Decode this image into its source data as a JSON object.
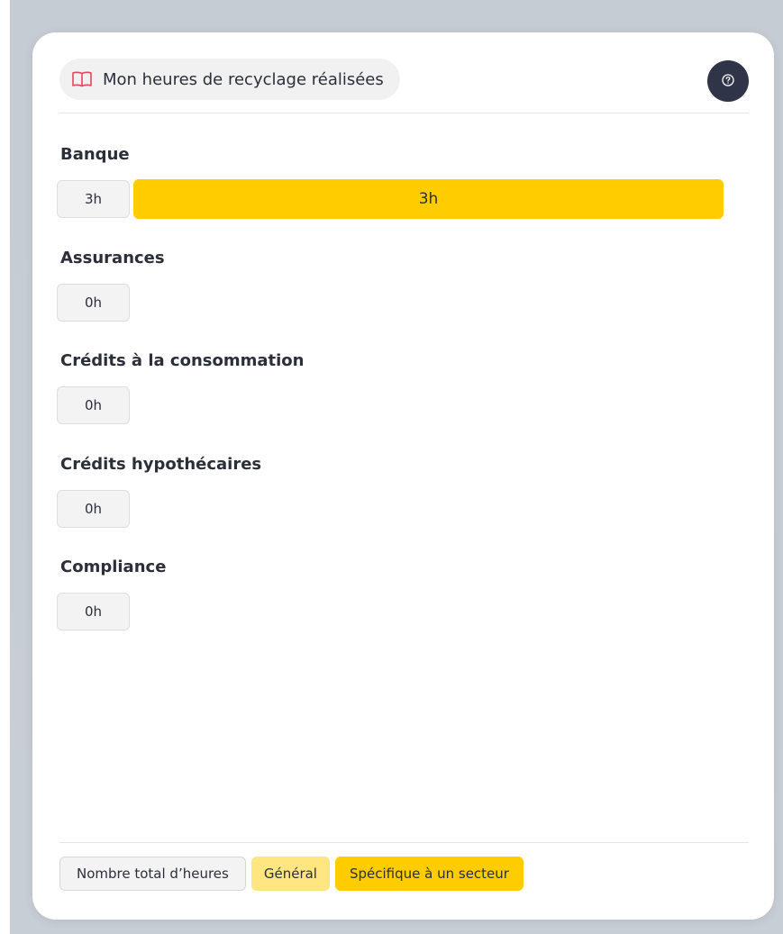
{
  "card": {
    "title": "Mon heures de recyclage réalisées",
    "title_icon": "book-open-icon",
    "help_icon": "question-circle-icon"
  },
  "colors": {
    "general": "#ffe680",
    "specific": "#ffcc00",
    "total_box": "#f3f3f4",
    "help_button": "#2f3449",
    "book_icon": "#e8455a"
  },
  "bar_max_hours": 3,
  "sectors": [
    {
      "label": "Banque",
      "total": "3h",
      "general_hours": 0,
      "specific_hours": 3,
      "specific_label": "3h"
    },
    {
      "label": "Assurances",
      "total": "0h",
      "general_hours": 0,
      "specific_hours": 0,
      "specific_label": ""
    },
    {
      "label": "Crédits à la consommation",
      "total": "0h",
      "general_hours": 0,
      "specific_hours": 0,
      "specific_label": ""
    },
    {
      "label": "Crédits hypothécaires",
      "total": "0h",
      "general_hours": 0,
      "specific_hours": 0,
      "specific_label": ""
    },
    {
      "label": "Compliance",
      "total": "0h",
      "general_hours": 0,
      "specific_hours": 0,
      "specific_label": ""
    }
  ],
  "legend": {
    "total_label": "Nombre total d’heures",
    "general_label": "Général",
    "specific_label": "Spécifique à un secteur"
  }
}
